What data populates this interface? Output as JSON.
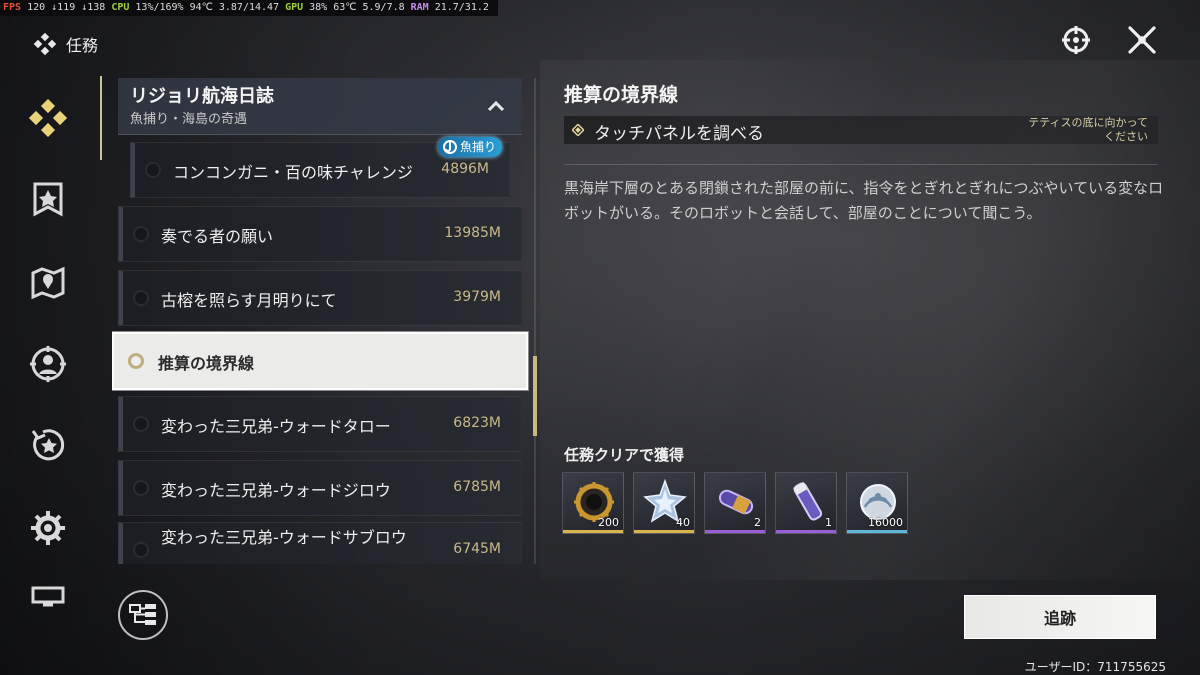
{
  "perf": {
    "fps_label": "FPS",
    "fps_value": "120 ↓119 ↓138",
    "cpu_label": "CPU",
    "cpu_value": "13%/169%",
    "cpu_temp": "94℃",
    "cpu_clock": "3.87/14.47",
    "gpu_label": "GPU",
    "gpu_value": "38%",
    "gpu_temp": "63℃",
    "gpu_mem": "5.9/7.8",
    "ram_label": "RAM",
    "ram_value": "21.7/31.2"
  },
  "header": {
    "title": "任務"
  },
  "group": {
    "title": "リジョリ航海日誌",
    "subtitle": "魚捕り・海島の奇遇"
  },
  "quests": [
    {
      "name": "コンコンガニ・百の味チャレンジ",
      "distance": "4896M",
      "tag": "魚捕り"
    },
    {
      "name": "奏でる者の願い",
      "distance": "13985M"
    },
    {
      "name": "古榕を照らす月明りにて",
      "distance": "3979M"
    },
    {
      "name": "推算の境界線",
      "distance": "",
      "selected": true
    },
    {
      "name": "変わった三兄弟-ウォードタロー",
      "distance": "6823M"
    },
    {
      "name": "変わった三兄弟-ウォードジロウ",
      "distance": "6785M"
    },
    {
      "name": "変わった三兄弟-ウォードサブロウ",
      "distance": "6745M"
    }
  ],
  "detail": {
    "title": "推算の境界線",
    "objective": "タッチパネルを調べる",
    "objective_hint": "テティスの底に向かってください",
    "description": "黒海岸下層のとある閉鎖された部屋の前に、指令をとぎれとぎれにつぶやいている変なロボットがいる。そのロボットと会話して、部屋のことについて聞こう。"
  },
  "rewards": {
    "title": "任務クリアで獲得",
    "items": [
      {
        "icon": "gear-ring-icon",
        "qty": "200",
        "color": "#d9b44a"
      },
      {
        "icon": "crystal-star-icon",
        "qty": "40",
        "color": "#d9b44a"
      },
      {
        "icon": "capsule-icon",
        "qty": "2",
        "color": "#9b5ed6"
      },
      {
        "icon": "vial-icon",
        "qty": "1",
        "color": "#9b5ed6"
      },
      {
        "icon": "shell-coin-icon",
        "qty": "16000",
        "color": "#5fb6d6"
      }
    ]
  },
  "track_button": "追跡",
  "user_id": "ユーザーID：711755625"
}
